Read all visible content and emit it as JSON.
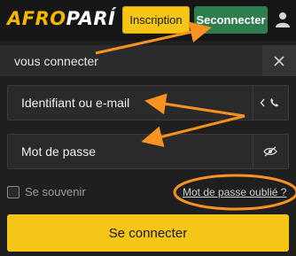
{
  "header": {
    "logo_part1": "AFRO",
    "logo_part2": "PARÍ",
    "register_label": "Inscription",
    "login_label": "Seconnecter",
    "user_icon": "user-icon"
  },
  "dialog": {
    "title": "vous connecter",
    "close_icon": "close-icon"
  },
  "form": {
    "login_field": {
      "placeholder": "Identifiant ou e-mail",
      "value": "",
      "suffix_icons": [
        "chevron-left-icon",
        "phone-icon"
      ]
    },
    "password_field": {
      "placeholder": "Mot de passe",
      "value": "",
      "suffix_icon": "eye-off-icon"
    },
    "remember_label": "Se souvenir",
    "remember_checked": false,
    "forgot_label": "Mot de passe oublié ?",
    "submit_label": "Se connecter"
  },
  "colors": {
    "brand_yellow": "#f5c518",
    "login_green": "#2e7d4f",
    "annotation_orange": "#f7931e",
    "background": "#121212"
  }
}
